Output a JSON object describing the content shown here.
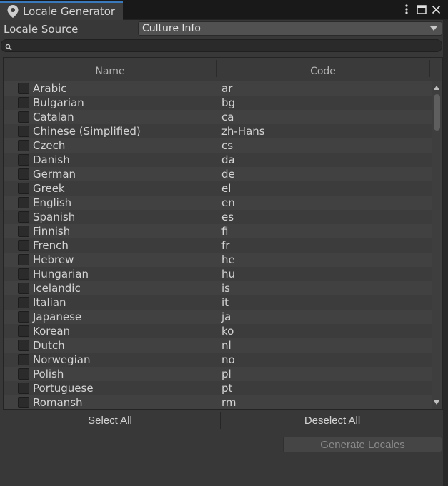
{
  "window": {
    "title": "Locale Generator",
    "icons": {
      "tab": "map-pin-icon",
      "menu": "kebab-menu-icon",
      "maximize": "maximize-icon",
      "close": "close-icon"
    }
  },
  "source": {
    "label": "Locale Source",
    "value": "Culture Info"
  },
  "search": {
    "placeholder": "",
    "value": ""
  },
  "table": {
    "columns": [
      "Name",
      "Code"
    ],
    "rows": [
      {
        "name": "Arabic",
        "code": "ar"
      },
      {
        "name": "Bulgarian",
        "code": "bg"
      },
      {
        "name": "Catalan",
        "code": "ca"
      },
      {
        "name": "Chinese (Simplified)",
        "code": "zh-Hans"
      },
      {
        "name": "Czech",
        "code": "cs"
      },
      {
        "name": "Danish",
        "code": "da"
      },
      {
        "name": "German",
        "code": "de"
      },
      {
        "name": "Greek",
        "code": "el"
      },
      {
        "name": "English",
        "code": "en"
      },
      {
        "name": "Spanish",
        "code": "es"
      },
      {
        "name": "Finnish",
        "code": "fi"
      },
      {
        "name": "French",
        "code": "fr"
      },
      {
        "name": "Hebrew",
        "code": "he"
      },
      {
        "name": "Hungarian",
        "code": "hu"
      },
      {
        "name": "Icelandic",
        "code": "is"
      },
      {
        "name": "Italian",
        "code": "it"
      },
      {
        "name": "Japanese",
        "code": "ja"
      },
      {
        "name": "Korean",
        "code": "ko"
      },
      {
        "name": "Dutch",
        "code": "nl"
      },
      {
        "name": "Norwegian",
        "code": "no"
      },
      {
        "name": "Polish",
        "code": "pl"
      },
      {
        "name": "Portuguese",
        "code": "pt"
      },
      {
        "name": "Romansh",
        "code": "rm"
      }
    ],
    "scroll_position": 0,
    "scroll_visible_fraction": 0.12
  },
  "buttons": {
    "select_all": "Select All",
    "deselect_all": "Deselect All",
    "generate": "Generate Locales"
  },
  "colors": {
    "accent": "#3a79bb",
    "background": "#383838",
    "row_even": "#3c3c3c",
    "row_odd": "#414141"
  }
}
